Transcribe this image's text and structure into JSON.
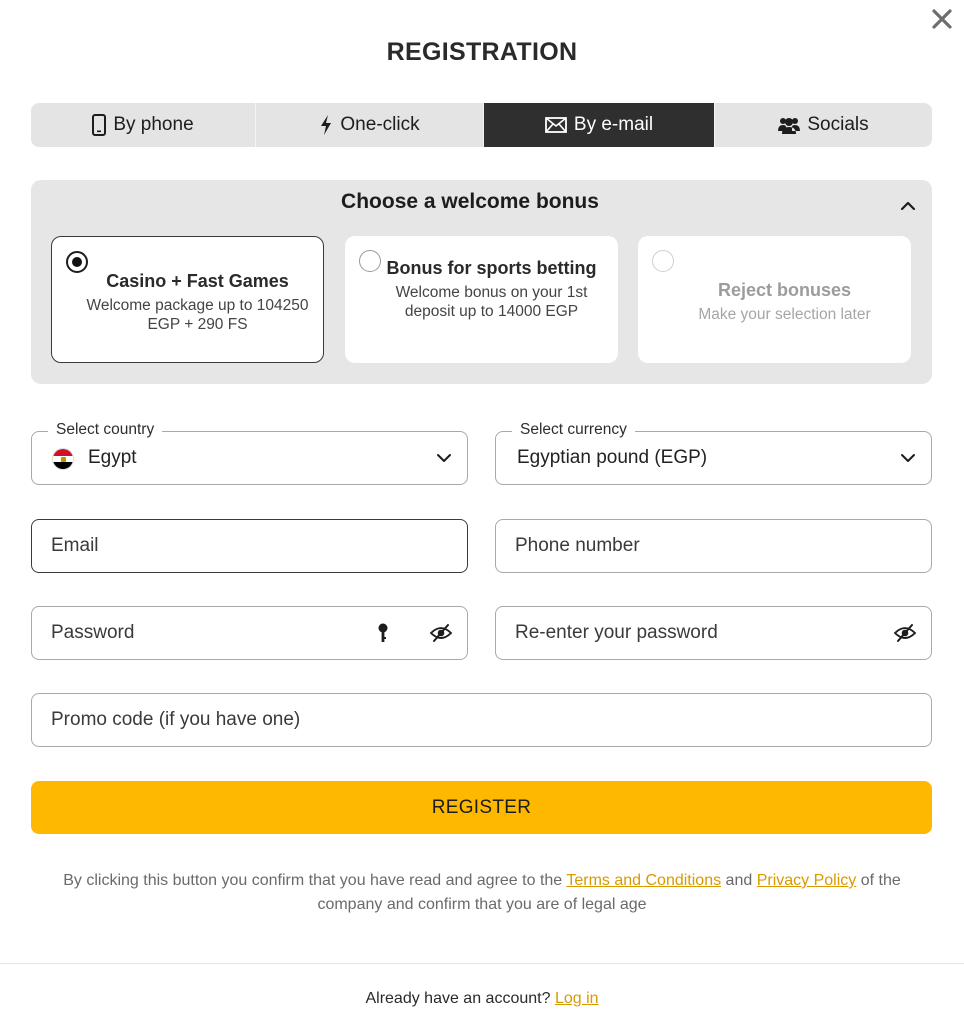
{
  "header": {
    "title": "REGISTRATION",
    "close_icon": "close-icon"
  },
  "tabs": [
    {
      "label": "By phone",
      "icon": "mobile-phone-icon",
      "active": false
    },
    {
      "label": "One-click",
      "icon": "lightning-icon",
      "active": false
    },
    {
      "label": "By e-mail",
      "icon": "envelope-icon",
      "active": true
    },
    {
      "label": "Socials",
      "icon": "users-icon",
      "active": false
    }
  ],
  "bonus": {
    "title": "Choose a welcome bonus",
    "options": [
      {
        "title": "Casino + Fast Games",
        "description": "Welcome package up to 104250 EGP + 290 FS",
        "selected": true
      },
      {
        "title": "Bonus for sports betting",
        "description": "Welcome bonus on your 1st deposit up to 14000 EGP",
        "selected": false
      },
      {
        "title": "Reject bonuses",
        "description": "Make your selection later",
        "selected": false
      }
    ]
  },
  "form": {
    "country": {
      "label": "Select country",
      "value": "Egypt"
    },
    "currency": {
      "label": "Select currency",
      "value": "Egyptian pound (EGP)"
    },
    "email": {
      "placeholder": "Email"
    },
    "phone": {
      "placeholder": "Phone number"
    },
    "password": {
      "placeholder": "Password"
    },
    "password_confirm": {
      "placeholder": "Re-enter your password"
    },
    "promo": {
      "placeholder": "Promo code (if you have one)"
    }
  },
  "register_button": "REGISTER",
  "legal": {
    "prefix": "By clicking this button you confirm that you have read and agree to the",
    "terms_link": "Terms and Conditions",
    "and": "and",
    "privacy_link": "Privacy Policy",
    "suffix": "of the company and confirm that you are of legal age"
  },
  "footer": {
    "text": "Already have an account?",
    "login_link": "Log in"
  },
  "colors": {
    "accent": "#ffb800",
    "link": "#d99a00",
    "active_tab": "#2f2f2f",
    "panel": "#e6e6e6"
  }
}
